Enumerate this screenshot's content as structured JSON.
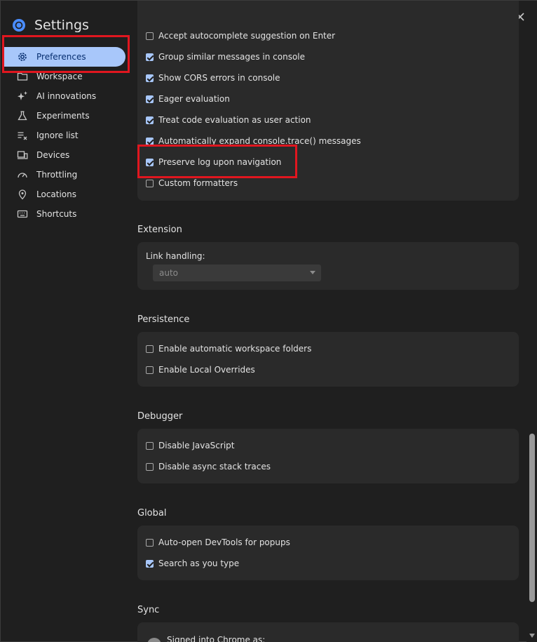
{
  "window": {
    "title": "Settings"
  },
  "sidebar": {
    "items": [
      {
        "label": "Preferences",
        "icon": "gear-icon",
        "active": true
      },
      {
        "label": "Workspace",
        "icon": "folder-icon"
      },
      {
        "label": "AI innovations",
        "icon": "sparkle-icon"
      },
      {
        "label": "Experiments",
        "icon": "flask-icon"
      },
      {
        "label": "Ignore list",
        "icon": "ignore-list-icon"
      },
      {
        "label": "Devices",
        "icon": "devices-icon"
      },
      {
        "label": "Throttling",
        "icon": "gauge-icon"
      },
      {
        "label": "Locations",
        "icon": "location-pin-icon"
      },
      {
        "label": "Shortcuts",
        "icon": "keyboard-icon"
      }
    ]
  },
  "console_group": {
    "options": [
      {
        "label": "Accept autocomplete suggestion on Enter",
        "checked": false
      },
      {
        "label": "Group similar messages in console",
        "checked": true
      },
      {
        "label": "Show CORS errors in console",
        "checked": true
      },
      {
        "label": "Eager evaluation",
        "checked": true
      },
      {
        "label": "Treat code evaluation as user action",
        "checked": true
      },
      {
        "label": "Automatically expand console.trace() messages",
        "checked": true
      },
      {
        "label": "Preserve log upon navigation",
        "checked": true
      },
      {
        "label": "Custom formatters",
        "checked": false
      }
    ]
  },
  "extension": {
    "title": "Extension",
    "link_handling_label": "Link handling:",
    "link_handling_value": "auto"
  },
  "persistence": {
    "title": "Persistence",
    "options": [
      {
        "label": "Enable automatic workspace folders",
        "checked": false
      },
      {
        "label": "Enable Local Overrides",
        "checked": false
      }
    ]
  },
  "debugger": {
    "title": "Debugger",
    "options": [
      {
        "label": "Disable JavaScript",
        "checked": false
      },
      {
        "label": "Disable async stack traces",
        "checked": false
      }
    ]
  },
  "global": {
    "title": "Global",
    "options": [
      {
        "label": "Auto-open DevTools for popups",
        "checked": false
      },
      {
        "label": "Search as you type",
        "checked": true
      }
    ]
  },
  "sync": {
    "title": "Sync",
    "signed_in_text": "Signed into Chrome as:"
  },
  "colors": {
    "accent": "#a8c7fa",
    "highlight": "#e0161f",
    "background": "#1f1f1f",
    "card": "#2a2a2a"
  }
}
